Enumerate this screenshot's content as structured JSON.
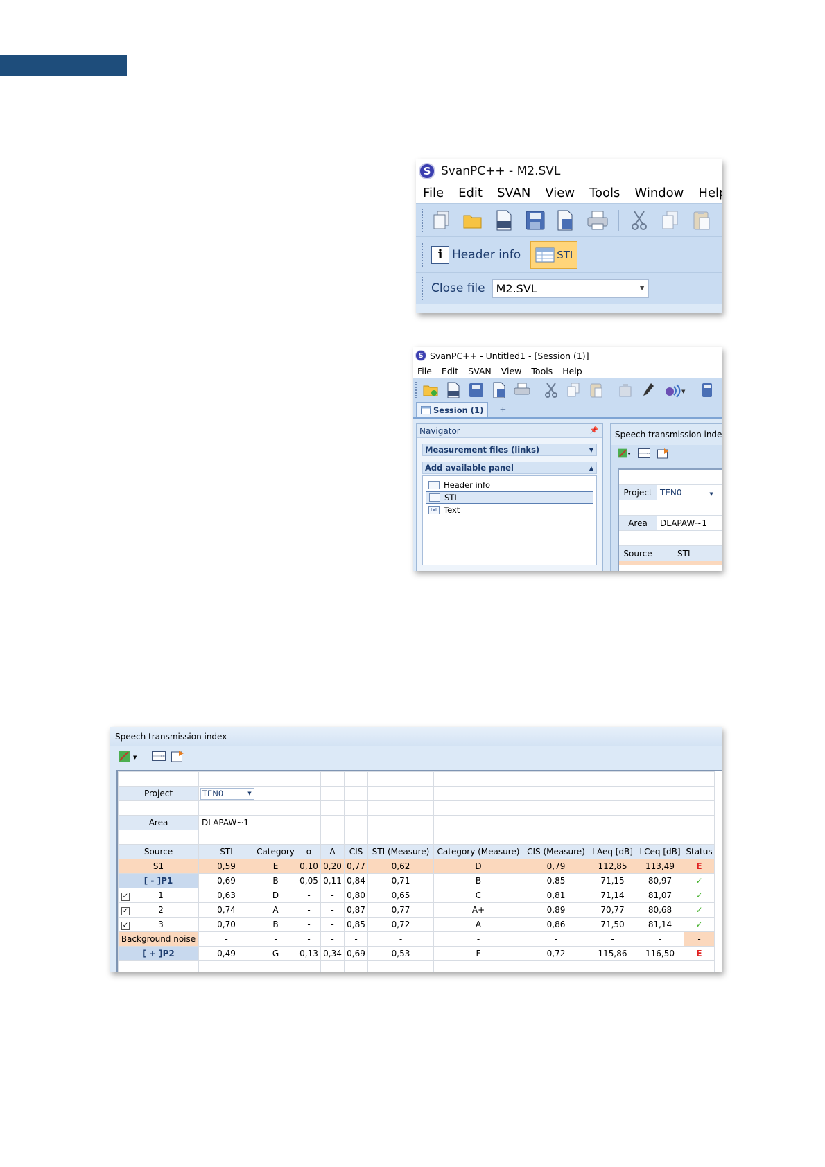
{
  "window1": {
    "title": "SvanPC++ - M2.SVL",
    "logo": "S",
    "menu": [
      "File",
      "Edit",
      "SVAN",
      "View",
      "Tools",
      "Window",
      "Help"
    ],
    "header_info_label": "Header info",
    "header_info_icon": "i",
    "sti_label": "STI",
    "close_file_label": "Close file",
    "file_combo_value": "M2.SVL"
  },
  "window2": {
    "title": "SvanPC++ - Untitled1 - [Session (1)]",
    "logo": "S",
    "menu": [
      "File",
      "Edit",
      "SVAN",
      "View",
      "Tools",
      "Help"
    ],
    "session_tab": "Session (1)",
    "tab_plus": "+",
    "navigator": {
      "title": "Navigator",
      "section_files": "Measurement files (links)",
      "section_panels": "Add available panel",
      "items": [
        "Header info",
        "STI",
        "Text"
      ],
      "text_icon_label": "txt"
    },
    "panel": {
      "title": "Speech transmission index",
      "project_label": "Project",
      "project_value": "TEN0",
      "area_label": "Area",
      "area_value": "DLAPAW~1",
      "col_source": "Source",
      "col_sti": "STI"
    }
  },
  "window3": {
    "title": "Speech transmission index",
    "project_label": "Project",
    "project_value": "TEN0",
    "area_label": "Area",
    "area_value": "DLAPAW~1",
    "columns": [
      "Source",
      "STI",
      "Category",
      "σ",
      "Δ",
      "CIS",
      "STI (Measure)",
      "Category (Measure)",
      "CIS (Measure)",
      "LAeq [dB]",
      "LCeq [dB]",
      "Status"
    ],
    "rows": [
      {
        "source": "S1",
        "values": [
          "0,59",
          "E",
          "0,10",
          "0,20",
          "0,77",
          "0,62",
          "D",
          "0,79",
          "112,85",
          "113,49",
          "E"
        ]
      },
      {
        "source": "[ - ]P1",
        "values": [
          "0,69",
          "B",
          "0,05",
          "0,11",
          "0,84",
          "0,71",
          "B",
          "0,85",
          "71,15",
          "80,97",
          "✓"
        ]
      },
      {
        "source": "1",
        "values": [
          "0,63",
          "D",
          "-",
          "-",
          "0,80",
          "0,65",
          "C",
          "0,81",
          "71,14",
          "81,07",
          "✓"
        ]
      },
      {
        "source": "2",
        "values": [
          "0,74",
          "A",
          "-",
          "-",
          "0,87",
          "0,77",
          "A+",
          "0,89",
          "70,77",
          "80,68",
          "✓"
        ]
      },
      {
        "source": "3",
        "values": [
          "0,70",
          "B",
          "-",
          "-",
          "0,85",
          "0,72",
          "A",
          "0,86",
          "71,50",
          "81,14",
          "✓"
        ]
      },
      {
        "source": "Background noise",
        "values": [
          "-",
          "-",
          "-",
          "-",
          "-",
          "-",
          "-",
          "-",
          "-",
          "-",
          "-"
        ]
      },
      {
        "source": "[ + ]P2",
        "values": [
          "0,49",
          "G",
          "0,13",
          "0,34",
          "0,69",
          "0,53",
          "F",
          "0,72",
          "115,86",
          "116,50",
          "E"
        ]
      }
    ],
    "checkmark": "✓"
  },
  "colors": {
    "page_tab": "#1e4d7b",
    "toolbar": "#c9dcf2",
    "highlight_row": "#fbd8bd",
    "status_error": "#e02020",
    "status_ok": "#43b02a"
  }
}
